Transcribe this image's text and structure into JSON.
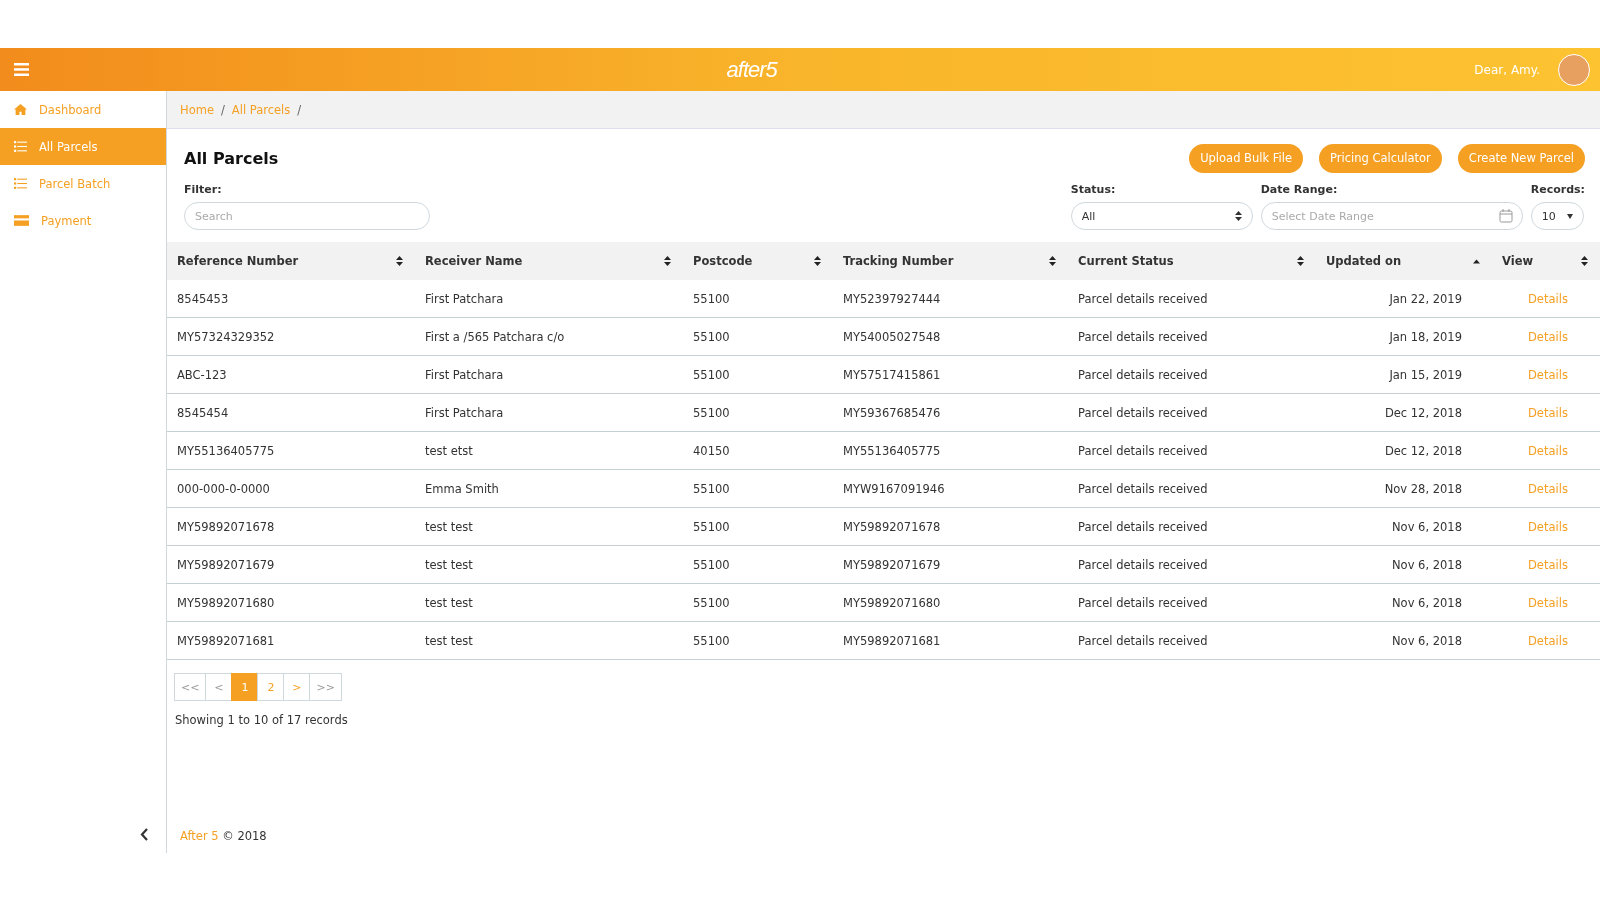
{
  "header": {
    "logo": "after5",
    "greeting": "Dear, Amy."
  },
  "sidebar": {
    "items": [
      {
        "label": "Dashboard",
        "kind": "home",
        "selected": false
      },
      {
        "label": "All Parcels",
        "kind": "list",
        "selected": true
      },
      {
        "label": "Parcel Batch",
        "kind": "list",
        "selected": false
      },
      {
        "label": "Payment",
        "kind": "card",
        "selected": false
      }
    ]
  },
  "breadcrumb": [
    {
      "kind": "link",
      "text": "Home"
    },
    {
      "kind": "separator",
      "text": "/"
    },
    {
      "kind": "link",
      "text": "All Parcels"
    },
    {
      "kind": "separator",
      "text": "/"
    }
  ],
  "page_title": "All Parcels",
  "actions": [
    "Upload Bulk File",
    "Pricing Calculator",
    "Create New Parcel"
  ],
  "filters": {
    "filter_label": "Filter:",
    "search_placeholder": "Search",
    "status_label": "Status:",
    "status_value": "All",
    "date_label": "Date Range:",
    "date_placeholder": "Select Date Range",
    "records_label": "Records:",
    "records_value": "10"
  },
  "table": {
    "columns": [
      {
        "label": "Reference Number",
        "kind": "sortable"
      },
      {
        "label": "Receiver Name",
        "kind": "sortable"
      },
      {
        "label": "Postcode",
        "kind": "sortable"
      },
      {
        "label": "Tracking Number",
        "kind": "sortable"
      },
      {
        "label": "Current Status",
        "kind": "sortable"
      },
      {
        "label": "Updated on",
        "kind": "sorted_ascending"
      },
      {
        "label": "View",
        "kind": "sortable"
      }
    ],
    "rows": [
      [
        "8545453",
        "First Patchara",
        "55100",
        "MY52397927444",
        "Parcel details received",
        "Jan 22, 2019",
        "Details"
      ],
      [
        "MY57324329352",
        "First a /565 Patchara c/o",
        "55100",
        "MY54005027548",
        "Parcel details received",
        "Jan 18, 2019",
        "Details"
      ],
      [
        "ABC-123",
        "First Patchara",
        "55100",
        "MY57517415861",
        "Parcel details received",
        "Jan 15, 2019",
        "Details"
      ],
      [
        "8545454",
        "First Patchara",
        "55100",
        "MY59367685476",
        "Parcel details received",
        "Dec 12, 2018",
        "Details"
      ],
      [
        "MY55136405775",
        "test etst",
        "40150",
        "MY55136405775",
        "Parcel details received",
        "Dec 12, 2018",
        "Details"
      ],
      [
        "000-000-0-0000",
        "Emma Smith",
        "55100",
        "MYW9167091946",
        "Parcel details received",
        "Nov 28, 2018",
        "Details"
      ],
      [
        "MY59892071678",
        "test test",
        "55100",
        "MY59892071678",
        "Parcel details received",
        "Nov 6, 2018",
        "Details"
      ],
      [
        "MY59892071679",
        "test test",
        "55100",
        "MY59892071679",
        "Parcel details received",
        "Nov 6, 2018",
        "Details"
      ],
      [
        "MY59892071680",
        "test test",
        "55100",
        "MY59892071680",
        "Parcel details received",
        "Nov 6, 2018",
        "Details"
      ],
      [
        "MY59892071681",
        "test test",
        "55100",
        "MY59892071681",
        "Parcel details received",
        "Nov 6, 2018",
        "Details"
      ]
    ]
  },
  "pagination": [
    {
      "label": "<<",
      "selected": false,
      "disabled": true
    },
    {
      "label": "<",
      "selected": false,
      "disabled": true
    },
    {
      "label": "1",
      "selected": true,
      "disabled": false
    },
    {
      "label": "2",
      "selected": false,
      "disabled": false
    },
    {
      "label": ">",
      "selected": false,
      "disabled": false
    },
    {
      "label": ">>",
      "selected": false,
      "disabled": true
    }
  ],
  "summary": "Showing 1 to 10 of 17 records",
  "footer": {
    "brand": "After 5",
    "copyright": "© 2018"
  }
}
